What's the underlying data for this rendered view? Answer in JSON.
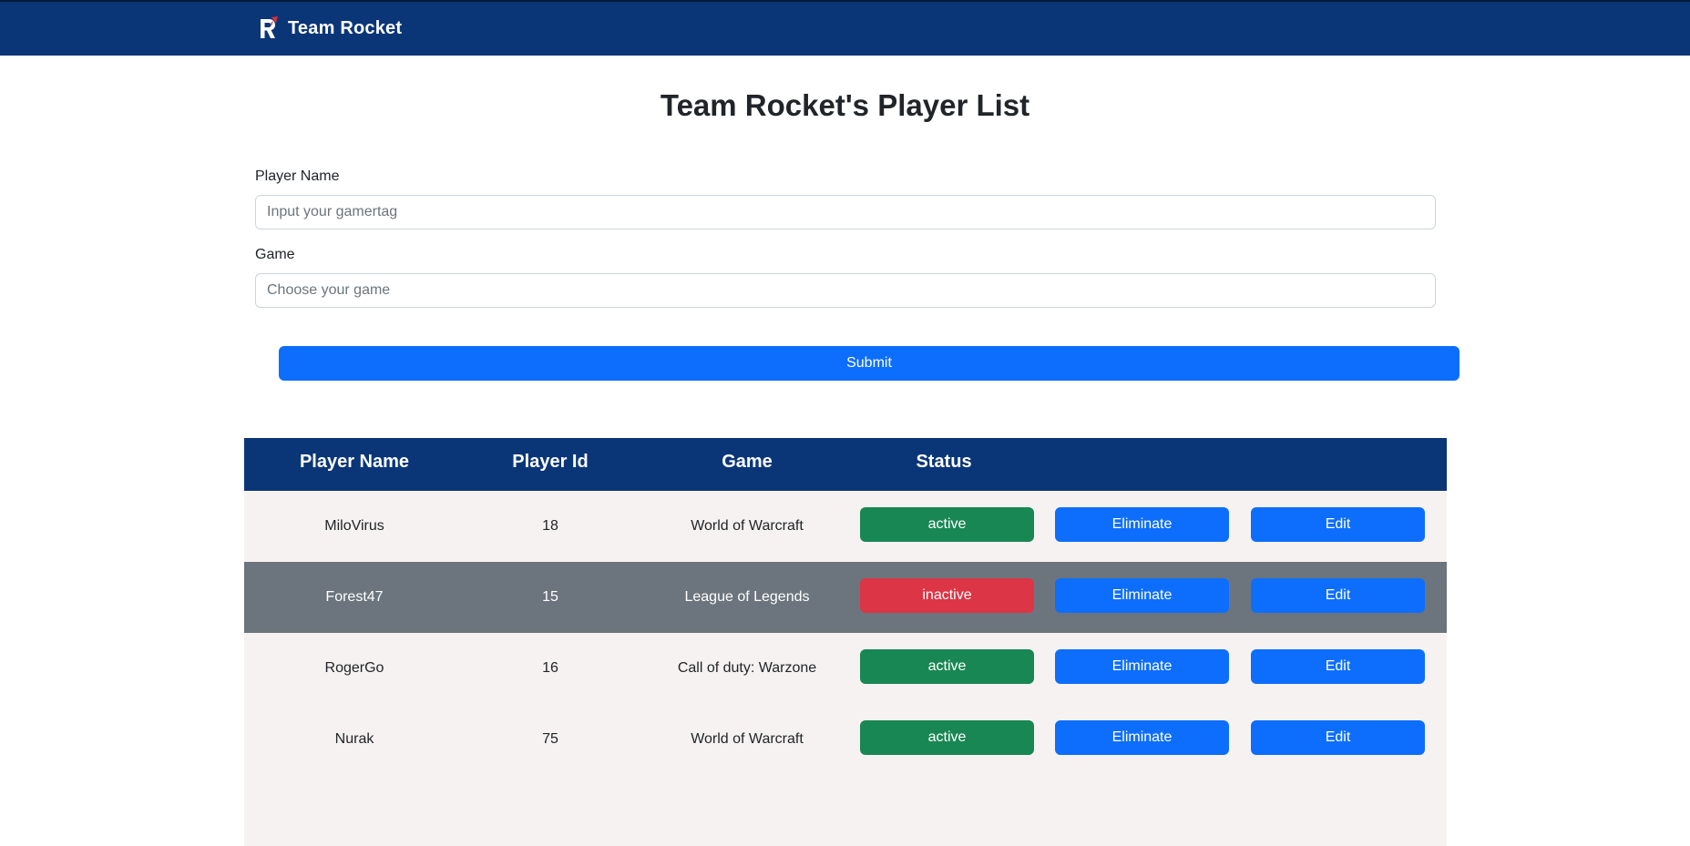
{
  "navbar": {
    "brand": "Team Rocket",
    "logo_icon": "rocket-r-logo-icon",
    "background": "#0a3678"
  },
  "page": {
    "title": "Team Rocket's Player List"
  },
  "form": {
    "player_name_label": "Player Name",
    "player_name_placeholder": "Input your gamertag",
    "player_name_value": "",
    "game_label": "Game",
    "game_placeholder": "Choose your game",
    "game_value": "",
    "submit_label": "Submit"
  },
  "table": {
    "headers": [
      "Player Name",
      "Player Id",
      "Game",
      "Status"
    ],
    "header_background": "#0a3678",
    "rows": [
      {
        "name": "MiloVirus",
        "id": "18",
        "game": "World of Warcraft",
        "status": "active",
        "eliminate": "Eliminate",
        "edit": "Edit",
        "highlighted": false
      },
      {
        "name": "Forest47",
        "id": "15",
        "game": "League of Legends",
        "status": "inactive",
        "eliminate": "Eliminate",
        "edit": "Edit",
        "highlighted": true
      },
      {
        "name": "RogerGo",
        "id": "16",
        "game": "Call of duty: Warzone",
        "status": "active",
        "eliminate": "Eliminate",
        "edit": "Edit",
        "highlighted": false
      },
      {
        "name": "Nurak",
        "id": "75",
        "game": "World of Warcraft",
        "status": "active",
        "eliminate": "Eliminate",
        "edit": "Edit",
        "highlighted": false
      }
    ]
  },
  "colors": {
    "primary": "#0d6efd",
    "success": "#198754",
    "danger": "#dc3545",
    "row_highlight": "#6c757d",
    "table_body": "#f6f2f1"
  }
}
